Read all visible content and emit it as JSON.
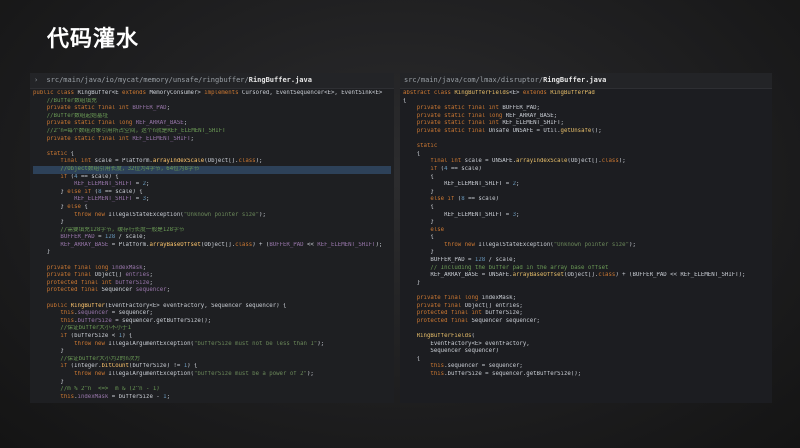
{
  "slide": {
    "title": "代码灌水"
  },
  "left": {
    "path_prefix": "src/main/java/io/mycat/memory/unsafe/ringbuffer/",
    "path_file": "RingBuffer.java",
    "lines": [
      [
        [
          "k",
          "public class "
        ],
        [
          "t",
          "RingBuffer"
        ],
        [
          "t",
          "<E "
        ],
        [
          "k",
          "extends "
        ],
        [
          "t",
          "MemoryConsumer> "
        ],
        [
          "k",
          "implements "
        ],
        [
          "t",
          "Cursored, EventSequencer<E>, EventSink<E>"
        ]
      ],
      [
        [
          "c",
          "    //Buffer数组填充"
        ]
      ],
      [
        [
          "k",
          "    private static final int "
        ],
        [
          "v",
          "BUFFER_PAD"
        ],
        [
          "t",
          ";"
        ]
      ],
      [
        [
          "c",
          "    //Buffer数组起始基址"
        ]
      ],
      [
        [
          "k",
          "    private static final long "
        ],
        [
          "v",
          "REF_ARRAY_BASE"
        ],
        [
          "t",
          ";"
        ]
      ],
      [
        [
          "c",
          "    //2^n=每个数组对象引用所占空间，这个n就是REF_ELEMENT_SHIFT"
        ]
      ],
      [
        [
          "k",
          "    private static final int "
        ],
        [
          "v",
          "REF_ELEMENT_SHIFT"
        ],
        [
          "t",
          ";"
        ]
      ],
      [
        [
          "t",
          ""
        ]
      ],
      [
        [
          "k",
          "    static "
        ],
        [
          "t",
          "{"
        ]
      ],
      [
        [
          "k",
          "        final int "
        ],
        [
          "t",
          "scale = Platform."
        ],
        [
          "f",
          "arrayIndexScale"
        ],
        [
          "t",
          "(Object[]."
        ],
        [
          "k",
          "class"
        ],
        [
          "t",
          ");"
        ]
      ],
      [
        [
          "c",
          "        //Object数组引用长度，32位为4字节，64位为8字节"
        ]
      ],
      [
        [
          "k",
          "        if "
        ],
        [
          "t",
          "("
        ],
        [
          "n",
          "4"
        ],
        [
          "t",
          " == scale) {"
        ]
      ],
      [
        [
          "v",
          "            REF_ELEMENT_SHIFT"
        ],
        [
          "t",
          " = "
        ],
        [
          "n",
          "2"
        ],
        [
          "t",
          ";"
        ]
      ],
      [
        [
          "t",
          "        } "
        ],
        [
          "k",
          "else if "
        ],
        [
          "t",
          "("
        ],
        [
          "n",
          "8"
        ],
        [
          "t",
          " == scale) {"
        ]
      ],
      [
        [
          "v",
          "            REF_ELEMENT_SHIFT"
        ],
        [
          "t",
          " = "
        ],
        [
          "n",
          "3"
        ],
        [
          "t",
          ";"
        ]
      ],
      [
        [
          "t",
          "        } "
        ],
        [
          "k",
          "else "
        ],
        [
          "t",
          "{"
        ]
      ],
      [
        [
          "k",
          "            throw new "
        ],
        [
          "t",
          "IllegalStateException("
        ],
        [
          "s",
          "\"Unknown pointer size\""
        ],
        [
          "t",
          ");"
        ]
      ],
      [
        [
          "t",
          "        }"
        ]
      ],
      [
        [
          "c",
          "        //需要填充128字节，缓存行长度一般是128字节"
        ]
      ],
      [
        [
          "v",
          "        BUFFER_PAD"
        ],
        [
          "t",
          " = "
        ],
        [
          "n",
          "128"
        ],
        [
          "t",
          " / scale;"
        ]
      ],
      [
        [
          "v",
          "        REF_ARRAY_BASE"
        ],
        [
          "t",
          " = Platform."
        ],
        [
          "f",
          "arrayBaseOffset"
        ],
        [
          "t",
          "(Object[]."
        ],
        [
          "k",
          "class"
        ],
        [
          "t",
          ") + ("
        ],
        [
          "v",
          "BUFFER_PAD"
        ],
        [
          "t",
          " << "
        ],
        [
          "v",
          "REF_ELEMENT_SHIFT"
        ],
        [
          "t",
          ");"
        ]
      ],
      [
        [
          "t",
          "    }"
        ]
      ],
      [
        [
          "t",
          ""
        ]
      ],
      [
        [
          "k",
          "    private final long "
        ],
        [
          "v",
          "indexMask"
        ],
        [
          "t",
          ";"
        ]
      ],
      [
        [
          "k",
          "    private final "
        ],
        [
          "t",
          "Object[] "
        ],
        [
          "v",
          "entries"
        ],
        [
          "t",
          ";"
        ]
      ],
      [
        [
          "k",
          "    protected final int "
        ],
        [
          "v",
          "bufferSize"
        ],
        [
          "t",
          ";"
        ]
      ],
      [
        [
          "k",
          "    protected final "
        ],
        [
          "t",
          "Sequencer "
        ],
        [
          "v",
          "sequencer"
        ],
        [
          "t",
          ";"
        ]
      ],
      [
        [
          "t",
          ""
        ]
      ],
      [
        [
          "k",
          "    public "
        ],
        [
          "f",
          "RingBuffer"
        ],
        [
          "t",
          "(EventFactory<E> eventFactory, Sequencer sequencer) {"
        ]
      ],
      [
        [
          "k",
          "        this"
        ],
        [
          "t",
          "."
        ],
        [
          "v",
          "sequencer"
        ],
        [
          "t",
          " = sequencer;"
        ]
      ],
      [
        [
          "k",
          "        this"
        ],
        [
          "t",
          "."
        ],
        [
          "v",
          "bufferSize"
        ],
        [
          "t",
          " = sequencer.getBufferSize();"
        ]
      ],
      [
        [
          "c",
          "        //保证buffer大小不小于1"
        ]
      ],
      [
        [
          "k",
          "        if "
        ],
        [
          "t",
          "(bufferSize < "
        ],
        [
          "n",
          "1"
        ],
        [
          "t",
          ") {"
        ]
      ],
      [
        [
          "k",
          "            throw new "
        ],
        [
          "t",
          "IllegalArgumentException("
        ],
        [
          "s",
          "\"bufferSize must not be less than 1\""
        ],
        [
          "t",
          ");"
        ]
      ],
      [
        [
          "t",
          "        }"
        ]
      ],
      [
        [
          "c",
          "        //保证buffer大小为2的n次方"
        ]
      ],
      [
        [
          "k",
          "        if "
        ],
        [
          "t",
          "(Integer."
        ],
        [
          "f",
          "bitCount"
        ],
        [
          "t",
          "(bufferSize) != "
        ],
        [
          "n",
          "1"
        ],
        [
          "t",
          ") {"
        ]
      ],
      [
        [
          "k",
          "            throw new "
        ],
        [
          "t",
          "IllegalArgumentException("
        ],
        [
          "s",
          "\"bufferSize must be a power of 2\""
        ],
        [
          "t",
          ");"
        ]
      ],
      [
        [
          "t",
          "        }"
        ]
      ],
      [
        [
          "c",
          "        //m % 2^n  <=>  m & (2^n - 1)"
        ]
      ],
      [
        [
          "k",
          "        this"
        ],
        [
          "t",
          "."
        ],
        [
          "v",
          "indexMask"
        ],
        [
          "t",
          " = bufferSize - "
        ],
        [
          "n",
          "1"
        ],
        [
          "t",
          ";"
        ]
      ]
    ]
  },
  "right": {
    "path_prefix": "src/main/java/com/lmax/disruptor/",
    "path_file": "RingBuffer.java",
    "lines": [
      [
        [
          "k",
          "abstract class "
        ],
        [
          "y",
          "RingBufferFields"
        ],
        [
          "t",
          "<E> "
        ],
        [
          "k",
          "extends "
        ],
        [
          "y",
          "RingBufferPad"
        ]
      ],
      [
        [
          "t",
          "{"
        ]
      ],
      [
        [
          "k",
          "    private static final int "
        ],
        [
          "t",
          "BUFFER_PAD;"
        ]
      ],
      [
        [
          "k",
          "    private static final long "
        ],
        [
          "t",
          "REF_ARRAY_BASE;"
        ]
      ],
      [
        [
          "k",
          "    private static final int "
        ],
        [
          "t",
          "REF_ELEMENT_SHIFT;"
        ]
      ],
      [
        [
          "k",
          "    private static final "
        ],
        [
          "t",
          "Unsafe UNSAFE = Util."
        ],
        [
          "y",
          "getUnsafe"
        ],
        [
          "t",
          "();"
        ]
      ],
      [
        [
          "t",
          ""
        ]
      ],
      [
        [
          "k",
          "    static"
        ]
      ],
      [
        [
          "t",
          "    {"
        ]
      ],
      [
        [
          "k",
          "        final int "
        ],
        [
          "t",
          "scale = UNSAFE."
        ],
        [
          "y",
          "arrayIndexScale"
        ],
        [
          "t",
          "(Object[]."
        ],
        [
          "k",
          "class"
        ],
        [
          "t",
          ");"
        ]
      ],
      [
        [
          "k",
          "        if "
        ],
        [
          "t",
          "("
        ],
        [
          "n",
          "4"
        ],
        [
          "t",
          " == scale)"
        ]
      ],
      [
        [
          "t",
          "        {"
        ]
      ],
      [
        [
          "t",
          "            REF_ELEMENT_SHIFT = "
        ],
        [
          "n",
          "2"
        ],
        [
          "t",
          ";"
        ]
      ],
      [
        [
          "t",
          "        }"
        ]
      ],
      [
        [
          "k",
          "        else if "
        ],
        [
          "t",
          "("
        ],
        [
          "n",
          "8"
        ],
        [
          "t",
          " == scale)"
        ]
      ],
      [
        [
          "t",
          "        {"
        ]
      ],
      [
        [
          "t",
          "            REF_ELEMENT_SHIFT = "
        ],
        [
          "n",
          "3"
        ],
        [
          "t",
          ";"
        ]
      ],
      [
        [
          "t",
          "        }"
        ]
      ],
      [
        [
          "k",
          "        else"
        ]
      ],
      [
        [
          "t",
          "        {"
        ]
      ],
      [
        [
          "k",
          "            throw new "
        ],
        [
          "t",
          "IllegalStateException("
        ],
        [
          "s",
          "\"Unknown pointer size\""
        ],
        [
          "t",
          ");"
        ]
      ],
      [
        [
          "t",
          "        }"
        ]
      ],
      [
        [
          "t",
          "        BUFFER_PAD = "
        ],
        [
          "n",
          "128"
        ],
        [
          "t",
          " / scale;"
        ]
      ],
      [
        [
          "c",
          "        // Including the buffer pad in the array base offset"
        ]
      ],
      [
        [
          "t",
          "        REF_ARRAY_BASE = UNSAFE."
        ],
        [
          "y",
          "arrayBaseOffset"
        ],
        [
          "t",
          "(Object[]."
        ],
        [
          "k",
          "class"
        ],
        [
          "t",
          ") + (BUFFER_PAD << REF_ELEMENT_SHIFT);"
        ]
      ],
      [
        [
          "t",
          "    }"
        ]
      ],
      [
        [
          "t",
          ""
        ]
      ],
      [
        [
          "k",
          "    private final long "
        ],
        [
          "t",
          "indexMask;"
        ]
      ],
      [
        [
          "k",
          "    private final "
        ],
        [
          "t",
          "Object[] entries;"
        ]
      ],
      [
        [
          "k",
          "    protected final int "
        ],
        [
          "t",
          "bufferSize;"
        ]
      ],
      [
        [
          "k",
          "    protected final "
        ],
        [
          "t",
          "Sequencer sequencer;"
        ]
      ],
      [
        [
          "t",
          ""
        ]
      ],
      [
        [
          "y",
          "    RingBufferFields"
        ],
        [
          "t",
          "("
        ]
      ],
      [
        [
          "t",
          "        EventFactory<E> eventFactory,"
        ]
      ],
      [
        [
          "t",
          "        Sequencer sequencer)"
        ]
      ],
      [
        [
          "t",
          "    {"
        ]
      ],
      [
        [
          "k",
          "        this"
        ],
        [
          "t",
          ".sequencer = sequencer;"
        ]
      ],
      [
        [
          "k",
          "        this"
        ],
        [
          "t",
          ".bufferSize = sequencer.getBufferSize();"
        ]
      ],
      [
        [
          "t",
          ""
        ]
      ],
      [
        [
          "t",
          ""
        ]
      ]
    ]
  }
}
